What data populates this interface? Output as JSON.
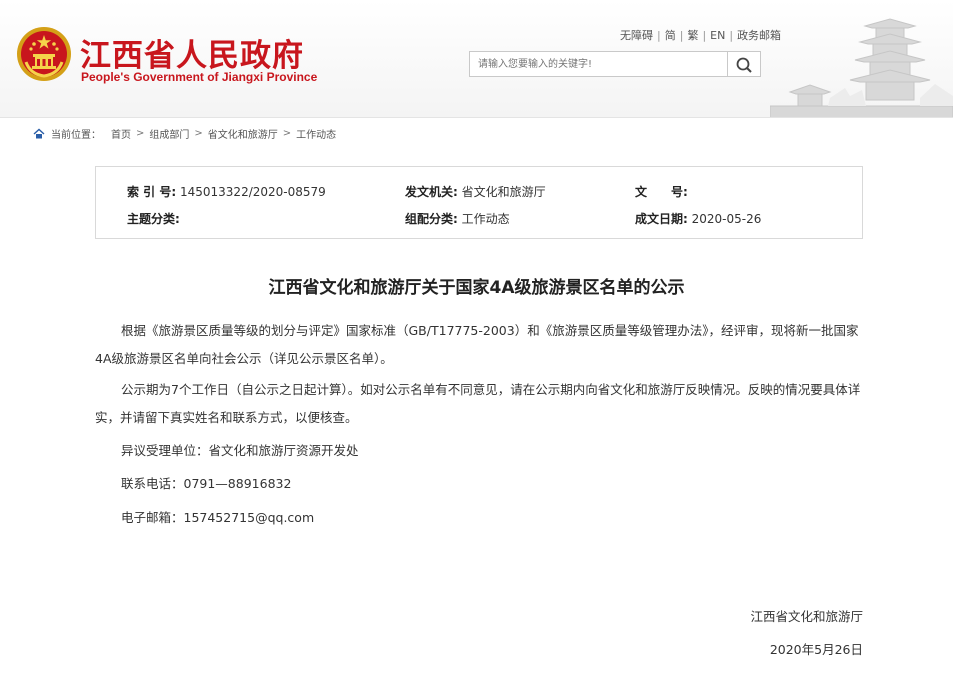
{
  "header": {
    "title": "江西省人民政府",
    "subtitle": "People's Government of Jiangxi Province",
    "links": [
      "无障碍",
      "简",
      "繁",
      "EN",
      "政务邮箱"
    ],
    "search_placeholder": "请输入您要输入的关键字!",
    "search_icon": "search-icon",
    "emblem_icon": "national-emblem-icon"
  },
  "breadcrumb": {
    "label": "当前位置：",
    "items": [
      "首页",
      "组成部门",
      "省文化和旅游厅",
      "工作动态"
    ],
    "separator": ">"
  },
  "info": {
    "index_key": "索 引 号:",
    "index_val": "145013322/2020-08579",
    "issuer_key": "发文机关:",
    "issuer_val": "省文化和旅游厅",
    "docno_key": "文　　号:",
    "docno_val": "",
    "topic_key": "主题分类:",
    "topic_val": "",
    "group_key": "组配分类:",
    "group_val": "工作动态",
    "date_key": "成文日期:",
    "date_val": "2020-05-26"
  },
  "article": {
    "title": "江西省文化和旅游厅关于国家4A级旅游景区名单的公示",
    "para1": "根据《旅游景区质量等级的划分与评定》国家标准（GB/T17775-2003）和《旅游景区质量等级管理办法》，经评审，现将新一批国家4A级旅游景区名单向社会公示（详见公示景区名单）。",
    "para2": "公示期为7个工作日（自公示之日起计算）。如对公示名单有不同意见，请在公示期内向省文化和旅游厅反映情况。反映的情况要具体详实，并请留下真实姓名和联系方式，以便核查。",
    "unit": "异议受理单位：省文化和旅游厅资源开发处",
    "phone": "联系电话：0791—88916832",
    "email": "电子邮箱：157452715@qq.com",
    "sign_org": "江西省文化和旅游厅",
    "sign_date": "2020年5月26日"
  },
  "colors": {
    "brand_red": "#c8161d",
    "border": "#d9d9d9"
  }
}
